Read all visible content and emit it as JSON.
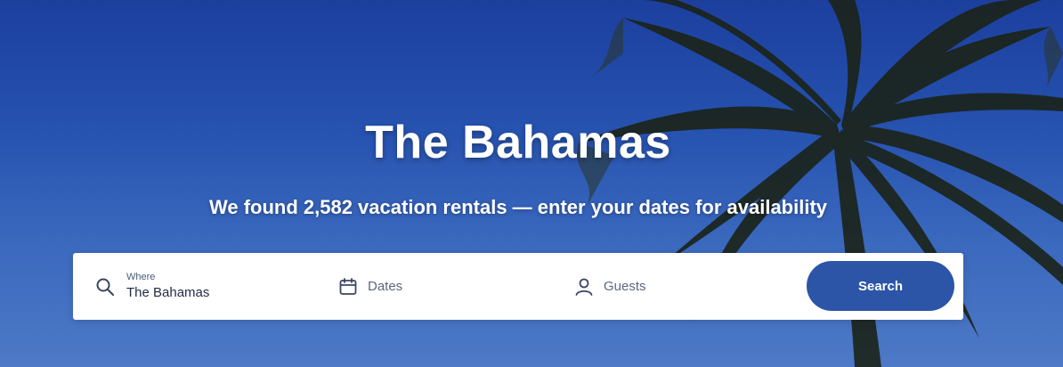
{
  "hero": {
    "title": "The Bahamas",
    "subtitle": "We found 2,582 vacation rentals — enter your dates for availability",
    "background_image": "palm-tree-against-blue-sky"
  },
  "search": {
    "where_label": "Where",
    "where_value": "The Bahamas",
    "dates_placeholder": "Dates",
    "guests_placeholder": "Guests",
    "button_label": "Search",
    "icons": {
      "where": "search-icon",
      "dates": "calendar-icon",
      "guests": "person-icon"
    }
  },
  "colors": {
    "sky_top": "#1c3f9e",
    "sky_bottom": "#4d79c6",
    "button": "#2c55a8",
    "text_on_hero": "#ffffff",
    "field_text": "#1f2a44"
  }
}
